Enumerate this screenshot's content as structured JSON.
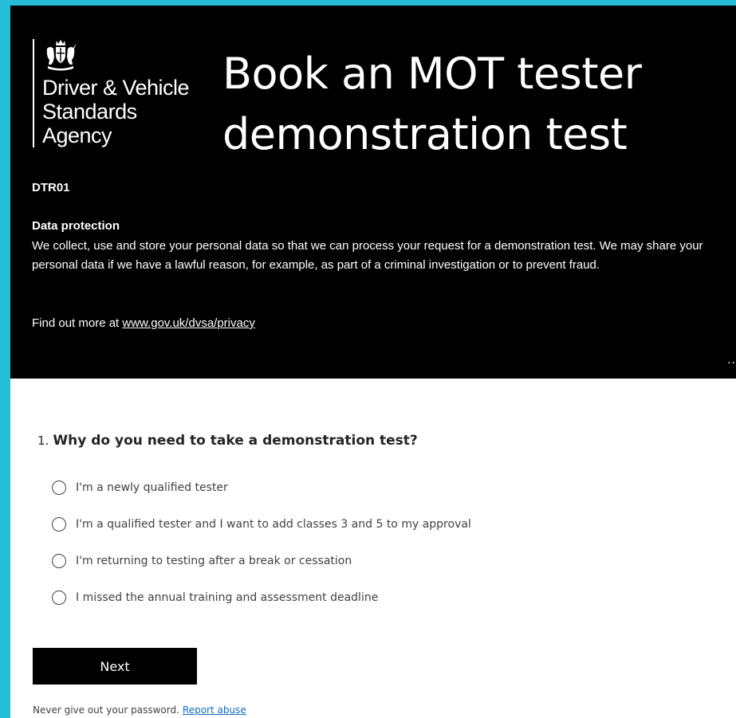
{
  "header": {
    "logo_text": "Driver & Vehicle\nStandards\nAgency",
    "title": "Book an MOT tester demonstration test",
    "form_code": "DTR01",
    "data_protection": {
      "heading": "Data protection",
      "body": "We collect, use and store your personal data so that we can process your request for a demonstration test. We may share your personal data if we have a lawful reason, for example, as part of a criminal investigation or to prevent fraud.",
      "find_more_prefix": "Find out more at ",
      "link_text": "www.gov.uk/dvsa/privacy"
    },
    "overflow_marker": "..",
    "background_color": "#000000"
  },
  "question": {
    "number": "1.",
    "text": "Why do you need to take a demonstration test?",
    "options": [
      {
        "label": "I'm a newly qualified tester"
      },
      {
        "label": "I'm a qualified tester and I want to add classes 3 and 5 to my approval"
      },
      {
        "label": "I'm returning to testing after a break or cessation"
      },
      {
        "label": "I missed the annual training and assessment deadline"
      }
    ]
  },
  "actions": {
    "next_label": "Next"
  },
  "footer": {
    "notice": "Never give out your password.",
    "report_link": "Report abuse"
  },
  "colors": {
    "page_border": "#25bcd8",
    "link": "#0f6cbd"
  },
  "icons": {
    "crest": "royal-coat-of-arms-icon",
    "radio": "radio-unchecked-icon"
  }
}
